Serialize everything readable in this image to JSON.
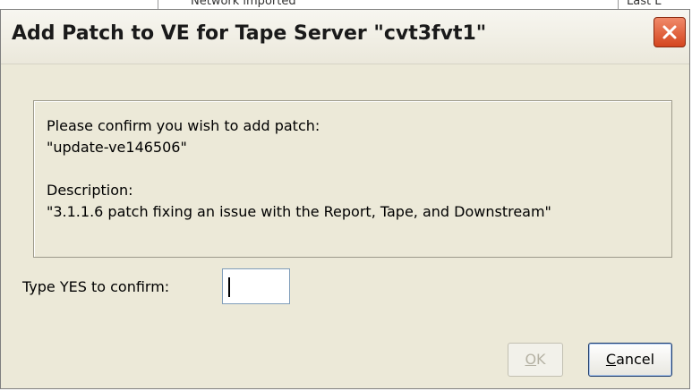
{
  "background": {
    "partial_text_left": "Network imported",
    "partial_text_right": "Last L"
  },
  "dialog": {
    "title": "Add Patch to VE for Tape Server \"cvt3fvt1\"",
    "close_icon": "close-icon",
    "message": {
      "line1": "Please confirm you wish to add patch:",
      "patch_name": "\"update-ve146506\"",
      "description_label": "Description:",
      "description": "\"3.1.1.6 patch fixing an issue with the Report, Tape, and Downstream\""
    },
    "confirm_label": "Type YES to confirm:",
    "confirm_value": "",
    "ok_label_mnemonic": "O",
    "ok_label_rest": "K",
    "ok_enabled": false,
    "cancel_label_mnemonic": "C",
    "cancel_label_rest": "ancel"
  },
  "colors": {
    "dialog_bg": "#ece9d8",
    "close_button": "#d4451e",
    "disabled_text": "#b5b2a4",
    "default_button_border": "#1c3a6a"
  }
}
